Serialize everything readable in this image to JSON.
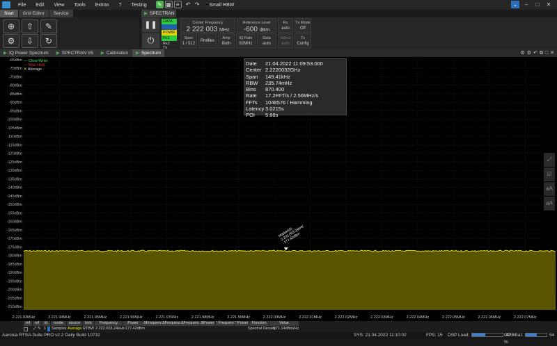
{
  "menu": {
    "items": [
      "File",
      "Edit",
      "View",
      "Tools",
      "Extras",
      "?",
      "Testing"
    ],
    "window_title": "Small RBW"
  },
  "left_tabs": [
    {
      "label": "Start",
      "selected": true
    },
    {
      "label": "Grid Editor",
      "selected": false
    },
    {
      "label": "Service",
      "selected": false
    }
  ],
  "device_tab": {
    "label": "SPECTRAN V6"
  },
  "controls": {
    "status": [
      {
        "label": "DATA",
        "color": "#2ecc40"
      },
      {
        "label": "",
        "color": "#1f5fae"
      },
      {
        "label": "POWR",
        "color": "#e6d200"
      },
      {
        "label": "Rx1",
        "color": "#2ecc40"
      },
      {
        "label": "Rx2",
        "color": ""
      },
      {
        "label": "Tx",
        "color": ""
      }
    ],
    "center_frequency": {
      "title": "Center Frequency",
      "value": "2 222 003",
      "unit": "MHz"
    },
    "reference_level": {
      "title": "Reference Level",
      "value": "-600",
      "unit": "dBm"
    },
    "rx": {
      "title": "Rx",
      "value": "auto"
    },
    "tx_mode": {
      "title": "Tx Mode",
      "value": "Off"
    },
    "span": {
      "title": "Span",
      "value": "1 / 512"
    },
    "profiles": {
      "title": "Profiles"
    },
    "amp": {
      "title": "Amp",
      "value": "Both"
    },
    "iq_rate": {
      "title": "IQ Rate",
      "value": "92MHz"
    },
    "data": {
      "title": "Data",
      "value": "auto"
    },
    "select": {
      "title": "Select",
      "value": "auto"
    },
    "tx_config": {
      "title": "Tx",
      "value": "Config"
    }
  },
  "window_tabs": [
    {
      "label": "IQ Power Spectrum",
      "selected": false
    },
    {
      "label": "SPECTRAN V6",
      "selected": false
    },
    {
      "label": "Calibration",
      "selected": false
    },
    {
      "label": "Spectrum",
      "selected": true
    }
  ],
  "legend": [
    {
      "label": "Clear/Write",
      "color": "#3ddc3d"
    },
    {
      "label": "Max Hold",
      "color": "#e03030"
    },
    {
      "label": "Average",
      "color": "#e8e800"
    }
  ],
  "info": [
    {
      "k": "Date",
      "v": "21.04.2022 11:09:53.000"
    },
    {
      "k": "Center",
      "v": "2.2220032GHz"
    },
    {
      "k": "Span",
      "v": "149.41kHz"
    },
    {
      "k": "RBW",
      "v": "235.74mHz"
    },
    {
      "k": "Bins",
      "v": "870.400"
    },
    {
      "k": "Rate",
      "v": "17.2FFT/s / 2.56MHz/s"
    },
    {
      "k": "FFTs",
      "v": "1048576 / Hamming"
    },
    {
      "k": "Latency",
      "v": "3.0215s"
    },
    {
      "k": "POI",
      "v": "5.88s"
    }
  ],
  "marker": {
    "name": "Marker(0)",
    "freq": "2.222.003.24kHz",
    "level": "-177.42dBm"
  },
  "chart_data": {
    "type": "line",
    "ylim": [
      -212,
      -65
    ],
    "xlim": [
      2221.93,
      2222.075
    ],
    "y_ticks": [
      "-65dBm",
      "-70dBm",
      "-75dBm",
      "-80dBm",
      "-85dBm",
      "-90dBm",
      "-95dBm",
      "-100dBm",
      "-105dBm",
      "-110dBm",
      "-115dBm",
      "-120dBm",
      "-125dBm",
      "-130dBm",
      "-135dBm",
      "-140dBm",
      "-145dBm",
      "-150dBm",
      "-155dBm",
      "-160dBm",
      "-165dBm",
      "-170dBm",
      "-175dBm",
      "-180dBm",
      "-185dBm",
      "-190dBm",
      "-195dBm",
      "-200dBm",
      "-205dBm",
      "-210dBm"
    ],
    "y_tick_values": [
      -65,
      -70,
      -75,
      -80,
      -85,
      -90,
      -95,
      -100,
      -105,
      -110,
      -115,
      -120,
      -125,
      -130,
      -135,
      -140,
      -145,
      -150,
      -155,
      -160,
      -165,
      -170,
      -175,
      -180,
      -185,
      -190,
      -195,
      -200,
      -205,
      -210
    ],
    "x_ticks": [
      "2.221.93MHz",
      "2.221.94MHz",
      "2.221.95MHz",
      "2.221.96MHz",
      "2.221.97MHz",
      "2.221.98MHz",
      "2.221.99MHz",
      "2.222.00MHz",
      "2.222.01MHz",
      "2.222.02MHz",
      "2.222.03MHz",
      "2.222.04MHz",
      "2.222.05MHz",
      "2.222.06MHz",
      "2.222.07MHz"
    ],
    "x_tick_values": [
      2221.93,
      2221.94,
      2221.95,
      2221.96,
      2221.97,
      2221.98,
      2221.99,
      2222.0,
      2222.01,
      2222.02,
      2222.03,
      2222.04,
      2222.05,
      2222.06,
      2222.07
    ],
    "series": [
      {
        "name": "Average",
        "color": "#e8e800",
        "level": -177.4
      }
    ]
  },
  "marker_table": {
    "headers": [
      "ref",
      "ref",
      "id",
      "mode",
      "source",
      "lock",
      "Frequency",
      "Power",
      "ΔFrequency",
      "ΔFrequency",
      "ΔFrequency",
      "ΔPower",
      "°.Frequency",
      "°.Power",
      "Function",
      "Value"
    ],
    "row": {
      "id": "1",
      "mode": "Samples",
      "source": "Average",
      "lock": "RTBW",
      "frequency": "2.222.003.24kHz",
      "power": "-177.42dBm",
      "function": "Spectral Density",
      "value": "-171.14dBm/Hz"
    }
  },
  "status": {
    "app": "Aaronia RTSA-Suite PRO v2.2 Daily Build 10732",
    "sys": "SYS: 21.04.2022 11:10:02",
    "fps": "FPS: 15",
    "dsp_label": "DSP Load:",
    "dsp": "42 %",
    "dsp_value": 0.42,
    "cpu_label": "CPU Sat:",
    "cpu": "54 %",
    "cpu_value": 0.54
  }
}
